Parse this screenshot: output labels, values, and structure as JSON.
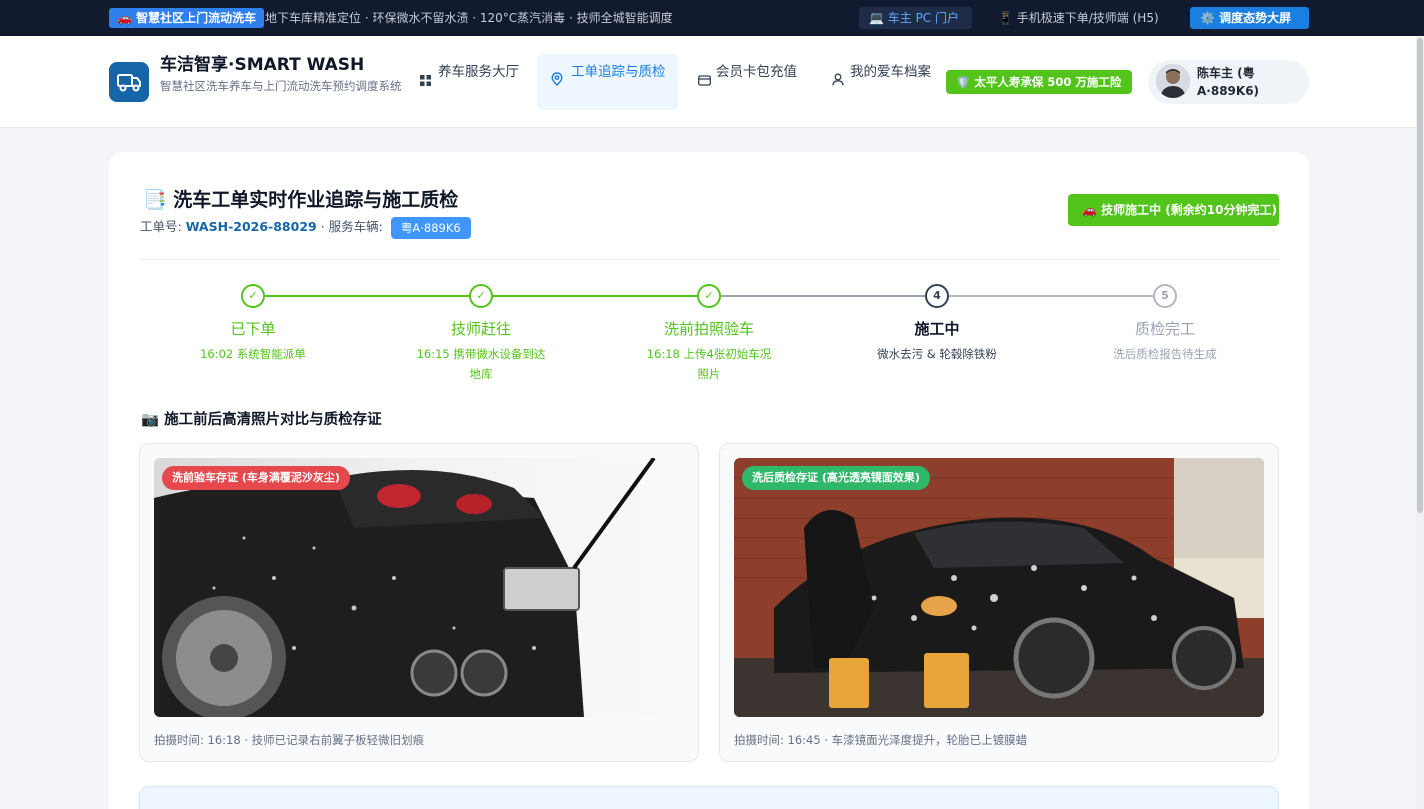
{
  "topbar": {
    "badge": "🚗 智慧社区上门流动洗车",
    "ticker": "地下车库精准定位 · 环保微水不留水渍 · 120°C蒸汽消毒 · 技师全城智能调度",
    "owner_pc": "💻 车主 PC 门户",
    "mobile_h5": "📱 手机极速下单/技师端 (H5)",
    "dispatch_screen": "⚙️ 调度态势大屏"
  },
  "brand": {
    "title": "车洁智享·SMART WASH",
    "subtitle": "智慧社区洗车养车与上门流动洗车预约调度系统"
  },
  "nav": {
    "items": [
      {
        "label": "养车服务大厅",
        "icon": "grid-icon"
      },
      {
        "label": "工单追踪与质检",
        "icon": "location-pin-icon"
      },
      {
        "label": "会员卡包充值",
        "icon": "card-icon"
      },
      {
        "label": "我的爱车档案",
        "icon": "user-icon"
      }
    ],
    "active_index": 1
  },
  "insurance": "🛡️ 太平人寿承保 500 万施工险",
  "user": {
    "name": "陈车主 (粤A·889K6)"
  },
  "order": {
    "title": "📑 洗车工单实时作业追踪与施工质检",
    "number_label": "工单号:",
    "number": "WASH-2026-88029",
    "vehicle_label": "· 服务车辆:",
    "plate": "粤A·889K6",
    "status": "🚗 技师施工中 (剩余约10分钟完工)"
  },
  "steps": [
    {
      "name": "已下单",
      "desc": "16:02 系统智能派单",
      "state": "done",
      "mark": "✓"
    },
    {
      "name": "技师赶往",
      "desc": "16:15 携带微水设备到达地库",
      "state": "done",
      "mark": "✓"
    },
    {
      "name": "洗前拍照验车",
      "desc": "16:18 上传4张初始车况照片",
      "state": "done",
      "mark": "✓"
    },
    {
      "name": "施工中",
      "desc": "微水去污 & 轮毂除铁粉",
      "state": "current",
      "mark": "4"
    },
    {
      "name": "质检完工",
      "desc": "洗后质检报告待生成",
      "state": "pending",
      "mark": "5"
    }
  ],
  "photos": {
    "section_title": "📷 施工前后高清照片对比与质检存证",
    "before": {
      "tag": "洗前验车存证 (车身满覆泥沙灰尘)",
      "caption": "拍摄时间: 16:18 · 技师已记录右前翼子板轻微旧划痕"
    },
    "after": {
      "tag": "洗后质检存证 (高光透亮镜面效果)",
      "caption": "拍摄时间: 16:45 · 车漆镜面光泽度提升，轮胎已上镀膜蜡"
    }
  },
  "colors": {
    "primary": "#1a7fe0",
    "success": "#52c41a",
    "danger": "#e5484d",
    "dark": "#111a2e"
  }
}
